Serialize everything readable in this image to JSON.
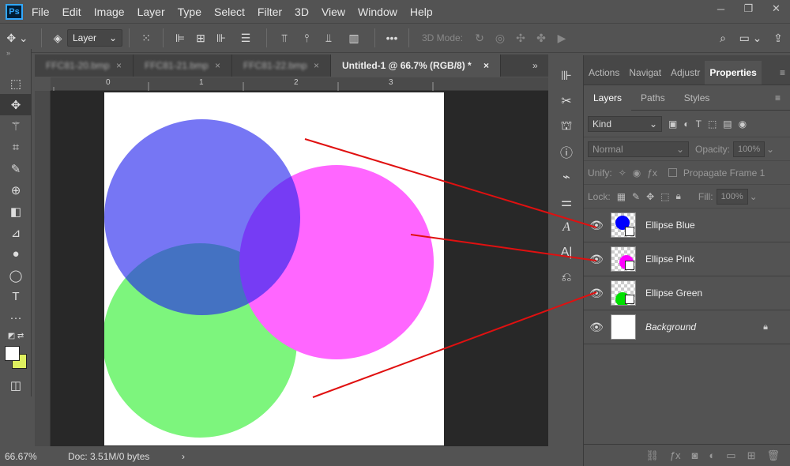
{
  "app": {
    "logo": "Ps"
  },
  "menu": [
    "File",
    "Edit",
    "Image",
    "Layer",
    "Type",
    "Select",
    "Filter",
    "3D",
    "View",
    "Window",
    "Help"
  ],
  "window_controls": [
    "─",
    "❐",
    "✕"
  ],
  "options": {
    "layer_select": "Layer",
    "mode_label": "3D Mode:"
  },
  "tabs": [
    {
      "label": "FFC81-20.bmp",
      "close": "×"
    },
    {
      "label": "FFC81-21.bmp",
      "close": "×"
    },
    {
      "label": "FFC81-22.bmp",
      "close": "×"
    },
    {
      "label": "Untitled-1 @ 66.7% (RGB/8) *",
      "close": "×"
    }
  ],
  "ruler": {
    "h_ticks": [
      "0",
      "1",
      "2",
      "3"
    ]
  },
  "status": {
    "zoom": "66.67%",
    "doc": "Doc: 3.51M/0 bytes",
    "arrow": "›"
  },
  "panel": {
    "top_tabs": [
      "Actions",
      "Navigat",
      "Adjustr",
      "Properties"
    ],
    "sub_tabs": [
      "Layers",
      "Paths",
      "Styles"
    ],
    "kind": "Kind",
    "blend_mode": "Normal",
    "opacity_label": "Opacity:",
    "opacity_value": "100%",
    "unify_label": "Unify:",
    "propagate_label": "Propagate Frame 1",
    "lock_label": "Lock:",
    "fill_label": "Fill:",
    "fill_value": "100%",
    "layers": [
      {
        "name": "Ellipse Blue",
        "color": "#0000ff"
      },
      {
        "name": "Ellipse Pink",
        "color": "#ff00ff"
      },
      {
        "name": "Ellipse Green",
        "color": "#00e000"
      },
      {
        "name": "Background",
        "color": "#ffffff"
      }
    ]
  },
  "colors": {
    "blue": "#6f6ff7",
    "pink": "#ff66ff",
    "green": "#7df57d",
    "arrow": "#e01010"
  }
}
